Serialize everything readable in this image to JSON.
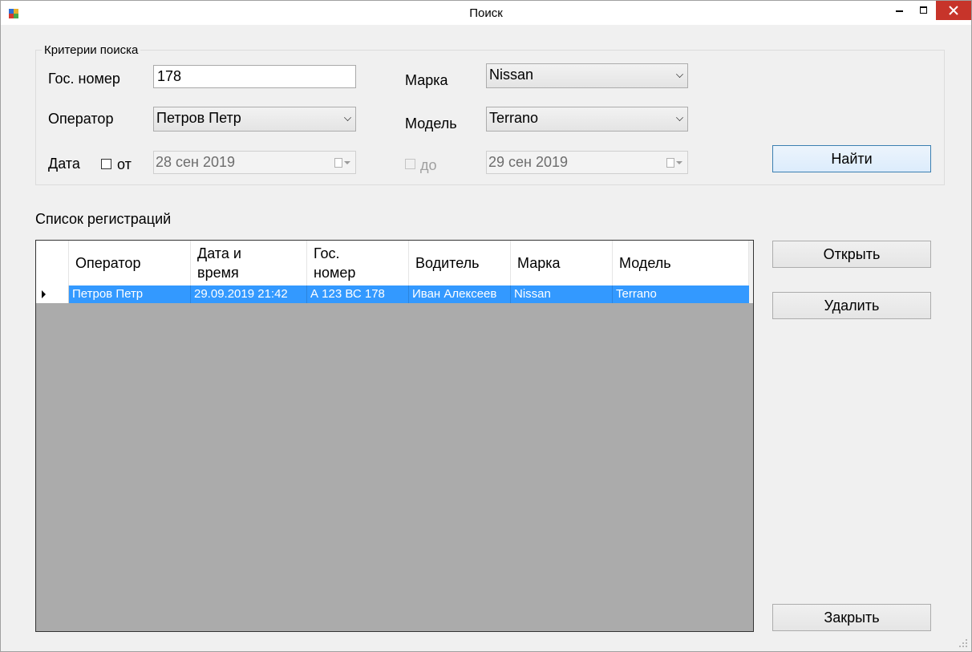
{
  "window": {
    "title": "Поиск"
  },
  "criteria": {
    "group_title": "Критерии поиска",
    "plate_label": "Гос. номер",
    "plate_value": "178",
    "operator_label": "Оператор",
    "operator_value": "Петров Петр",
    "date_label": "Дата",
    "from_label": "от",
    "from_checked": false,
    "from_date": "28 сен 2019",
    "to_label": "до",
    "to_checked": false,
    "to_date": "29 сен 2019",
    "brand_label": "Марка",
    "brand_value": "Nissan",
    "model_label": "Модель",
    "model_value": "Terrano",
    "find_button": "Найти"
  },
  "list": {
    "title": "Список регистраций",
    "columns": [
      "Оператор",
      "Дата и время",
      "Гос. номер",
      "Водитель",
      "Марка",
      "Модель"
    ],
    "columns_lines": [
      [
        "Оператор"
      ],
      [
        "Дата и",
        "время"
      ],
      [
        "Гос.",
        "номер"
      ],
      [
        "Водитель"
      ],
      [
        "Марка"
      ],
      [
        "Модель"
      ]
    ],
    "rows": [
      {
        "operator": "Петров Петр",
        "datetime": "29.09.2019 21:42",
        "plate": "А 123 ВС 178",
        "driver": "Иван Алексеев",
        "brand": "Nissan",
        "model": "Terrano",
        "selected": true
      }
    ]
  },
  "actions": {
    "open_button": "Открыть",
    "delete_button": "Удалить",
    "close_button": "Закрыть"
  },
  "colors": {
    "selection": "#3399ff",
    "grid_background": "#ababab",
    "close_button": "#c7342a"
  }
}
